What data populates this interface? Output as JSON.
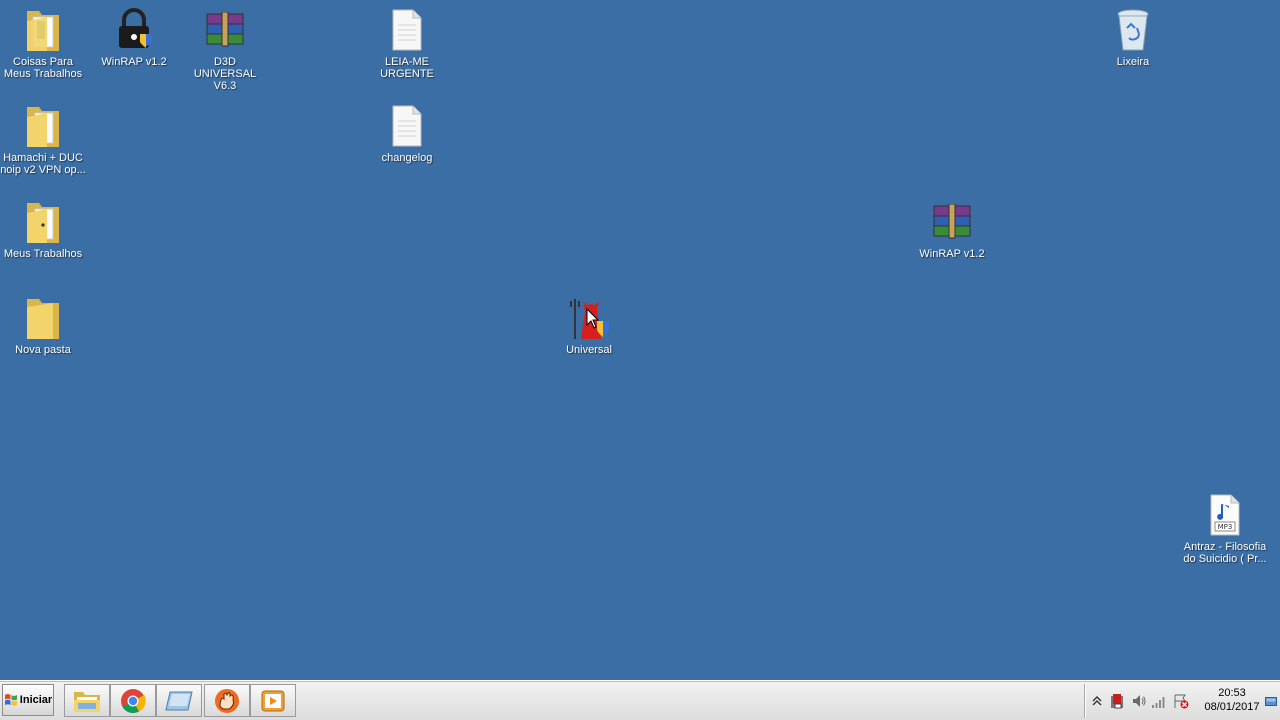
{
  "desktop": {
    "background_color": "#3a6ea5",
    "icons": [
      {
        "label": "Coisas Para Meus Trabalhos",
        "icon": "folder-with-document-icon"
      },
      {
        "label": "WinRAP v1.2",
        "icon": "lock-shield-icon"
      },
      {
        "label": "D3D UNIVERSAL V6.3",
        "icon": "winrar-archive-icon"
      },
      {
        "label": "LEIA-ME URGENTE",
        "icon": "text-document-icon"
      },
      {
        "label": "Lixeira",
        "icon": "recycle-bin-icon"
      },
      {
        "label": "Hamachi + DUC noip v2 VPN op...",
        "icon": "folder-icon"
      },
      {
        "label": "changelog",
        "icon": "text-document-icon"
      },
      {
        "label": "Meus Trabalhos",
        "icon": "folder-icon"
      },
      {
        "label": "WinRAP v1.2",
        "icon": "winrar-archive-icon"
      },
      {
        "label": "Nova pasta",
        "icon": "folder-icon"
      },
      {
        "label": "Universal",
        "icon": "devil-shield-icon"
      },
      {
        "label": "Antraz - Filosofia do Suicidio ( Pr...",
        "icon": "mp3-file-icon"
      }
    ]
  },
  "taskbar": {
    "start_label": "Iniciar",
    "pinned": [
      {
        "icon": "file-explorer-icon"
      },
      {
        "icon": "chrome-icon"
      },
      {
        "icon": "app-window-icon"
      },
      {
        "icon": "paw-icon"
      },
      {
        "icon": "media-player-icon"
      }
    ],
    "tray": {
      "time": "20:53",
      "date": "08/01/2017",
      "icons": [
        "chevron-up-icon",
        "antivirus-icon",
        "volume-icon",
        "network-icon",
        "error-flag-icon"
      ]
    }
  }
}
